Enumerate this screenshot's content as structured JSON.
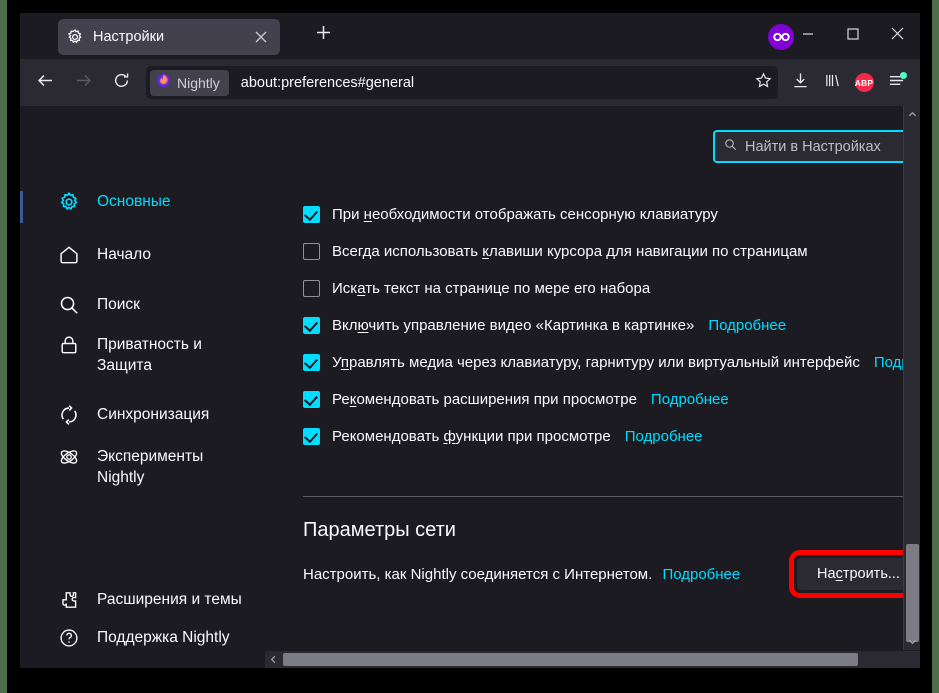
{
  "window": {
    "tab": {
      "title": "Настройки",
      "favicon_icon": "gear-icon",
      "close_icon": "close-icon"
    },
    "new_tab_icon": "plus-icon",
    "extension_badge_icon": "infinity-icon",
    "minimize_icon": "minimize-icon",
    "maximize_icon": "maximize-icon",
    "close_icon": "window-close-icon"
  },
  "navbar": {
    "back_icon": "arrow-left-icon",
    "forward_icon": "arrow-right-icon",
    "reload_icon": "reload-icon",
    "brand_label": "Nightly",
    "brand_icon": "firefox-nightly-icon",
    "url": "about:preferences#general",
    "bookmark_icon": "star-icon",
    "downloads_icon": "download-icon",
    "library_icon": "library-icon",
    "adblock_label": "ABP",
    "adblock_icon": "adblock-plus-icon",
    "menu_icon": "hamburger-menu-icon"
  },
  "sidebar": {
    "items": [
      {
        "label": "Основные",
        "icon": "gear-icon",
        "selected": true
      },
      {
        "label": "Начало",
        "icon": "home-icon",
        "selected": false
      },
      {
        "label": "Поиск",
        "icon": "search-icon",
        "selected": false
      },
      {
        "label": "Приватность и\nЗащита",
        "icon": "lock-icon",
        "selected": false
      },
      {
        "label": "Синхронизация",
        "icon": "sync-icon",
        "selected": false
      },
      {
        "label": "Эксперименты\nNightly",
        "icon": "atom-icon",
        "selected": false
      }
    ],
    "footer": [
      {
        "label": "Расширения и темы",
        "icon": "puzzle-icon"
      },
      {
        "label": "Поддержка Nightly",
        "icon": "question-circle-icon"
      }
    ]
  },
  "search": {
    "placeholder": "Найти в Настройках",
    "value": "",
    "icon": "search-icon",
    "focus_color": "#00ddff"
  },
  "main": {
    "checkboxes": [
      {
        "label": "При необходимости отображать сенсорную клавиатуру",
        "checked": true,
        "learn_more": ""
      },
      {
        "label": "Всегда использовать клавиши курсора для навигации по страницам",
        "checked": false,
        "learn_more": ""
      },
      {
        "label": "Искать текст на странице по мере его набора",
        "checked": false,
        "learn_more": ""
      },
      {
        "label": "Включить управление видео «Картинка в картинке»",
        "checked": true,
        "learn_more": "Подробнее"
      },
      {
        "label": "Управлять медиа через клавиатуру, гарнитуру или виртуальный интерфейс",
        "checked": true,
        "learn_more": "Подробне"
      },
      {
        "label": "Рекомендовать расширения при просмотре",
        "checked": true,
        "learn_more": "Подробнее"
      },
      {
        "label": "Рекомендовать функции при просмотре",
        "checked": true,
        "learn_more": "Подробнее"
      }
    ],
    "network_section": {
      "title": "Параметры сети",
      "description": "Настроить, как Nightly соединяется с Интернетом.",
      "learn_more": "Подробнее",
      "button_label": "Настроить...",
      "highlight_color": "#ff0000"
    }
  },
  "scrollbars": {
    "vertical_up_icon": "chevron-up-icon",
    "vertical_down_icon": "chevron-down-icon",
    "horizontal_left_icon": "chevron-left-icon",
    "horizontal_right_icon": "chevron-right-icon"
  }
}
